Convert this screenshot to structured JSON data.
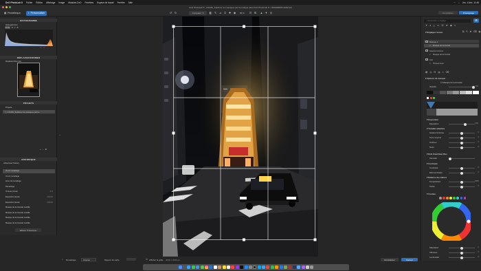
{
  "menubar": {
    "apple": "",
    "app": "DxO PhotoLab 8",
    "items": [
      "Fichier",
      "Édition",
      "Affichage",
      "Image",
      "Modules DxO",
      "Fenêtres",
      "Espace de travail",
      "Fenêtre",
      "Aide"
    ],
    "clock": "Jeu. 4 déc. 11:48"
  },
  "window": {
    "title": "DxO PhotoLab 8 - 210481_Sublimer les masques par la pratique dans DxO PhotoLab 8 > 0000088450.ARW (M)"
  },
  "tabs": {
    "library": "Photothèque",
    "customize": "Personnaliser",
    "compare": "Réinitialiser",
    "reset": "Réinitialiser",
    "before": "Comparer",
    "proto": "Prototypage",
    "preview": "Pleine résolution"
  },
  "tooltip": {
    "text": "Recadrage"
  },
  "toolbar": {
    "compare_label": "Comparer",
    "zoom": "86 %"
  },
  "left": {
    "histogram": "HISTOGRAMME",
    "histo_mode": "Histogramme",
    "histo_channels": [
      "RVB",
      "R",
      "V",
      "B"
    ],
    "histo_values": [
      "",
      "11",
      "11"
    ],
    "move": "DÉPLACER/ZOOMER",
    "zoom_label": "Déplacer/Zoomer",
    "projects": "PROJETS",
    "projects_label": "Projets",
    "project_item": "174481_Sublimer les masques par la...",
    "history": "HISTORIQUE",
    "history_sub": "Advanced history",
    "history_items": [
      {
        "label": "Ouvrir recadrage",
        "value": ""
      },
      {
        "label": "Ouvrir recadrage",
        "value": ""
      },
      {
        "label": "Zone de recadrage",
        "value": ""
      },
      {
        "label": "Recadrage",
        "value": ""
      },
      {
        "label": "Ombres (local)",
        "value": "-5 %"
      },
      {
        "label": "Exposition (local)",
        "value": "0,50 EV"
      },
      {
        "label": "Exposition (local)",
        "value": "0,00 EV"
      },
      {
        "label": "Masque de luminosité modifié",
        "value": ""
      },
      {
        "label": "Masque de luminosité modifié",
        "value": ""
      },
      {
        "label": "Masque de luminosité modifié",
        "value": ""
      },
      {
        "label": "Masque de luminosité modifié",
        "value": ""
      }
    ],
    "clear_history": "Effacer l'historique"
  },
  "right": {
    "search_placeholder": "Rechercher un réglage",
    "local_adjust": "Réglages locaux",
    "masks": [
      {
        "label": "Masque 1",
        "sub": "Masque de luminosité"
      },
      {
        "label": "Hautes lumières",
        "sub": "Masque de luminosité"
      },
      {
        "label": "Ciel",
        "sub": "Pinceau local"
      }
    ],
    "mask_options": "Options de masque",
    "luminosity_mask": "Masque de luminosité",
    "opacity_label": "Opacité",
    "opacity_value": "100",
    "exposure": "Exposition",
    "exposure_label": "Exposition",
    "exposure_value": "0,50",
    "tonality": "Tonalité sélective",
    "tone_rows": [
      {
        "label": "Hautes lumières",
        "value": "0"
      },
      {
        "label": "Tons moyens",
        "value": "0"
      },
      {
        "label": "Ombres",
        "value": "0"
      },
      {
        "label": "Noirs",
        "value": "0"
      }
    ],
    "clearview": "DxO ClearView Plus",
    "clearview_label": "Intensité",
    "contrast": "Contraste",
    "contrast_rows": [
      {
        "label": "Contraste",
        "value": "0"
      },
      {
        "label": "Microcontraste",
        "value": "0"
      }
    ],
    "wb": "Balance des blancs",
    "wb_rows": [
      {
        "label": "Température",
        "value": "5800"
      },
      {
        "label": "Teinte",
        "value": "0"
      }
    ],
    "color": "Couleur",
    "color_rows": [
      {
        "label": "Saturation",
        "value": "0"
      },
      {
        "label": "Vibrance",
        "value": "0"
      },
      {
        "label": "Luminosité",
        "value": "0"
      }
    ]
  },
  "bottom": {
    "crop_label": "Recadrage",
    "ratio": "Original",
    "ratio_hint": "Rapport de cadre",
    "grid_label": "Afficher la grille",
    "size": "4016 × 6016 px",
    "reset": "Réinitialiser",
    "done": "Fermer"
  },
  "colors": {
    "accent": "#2f6fb5",
    "panel": "#2a2a2a",
    "header": "#333333"
  }
}
